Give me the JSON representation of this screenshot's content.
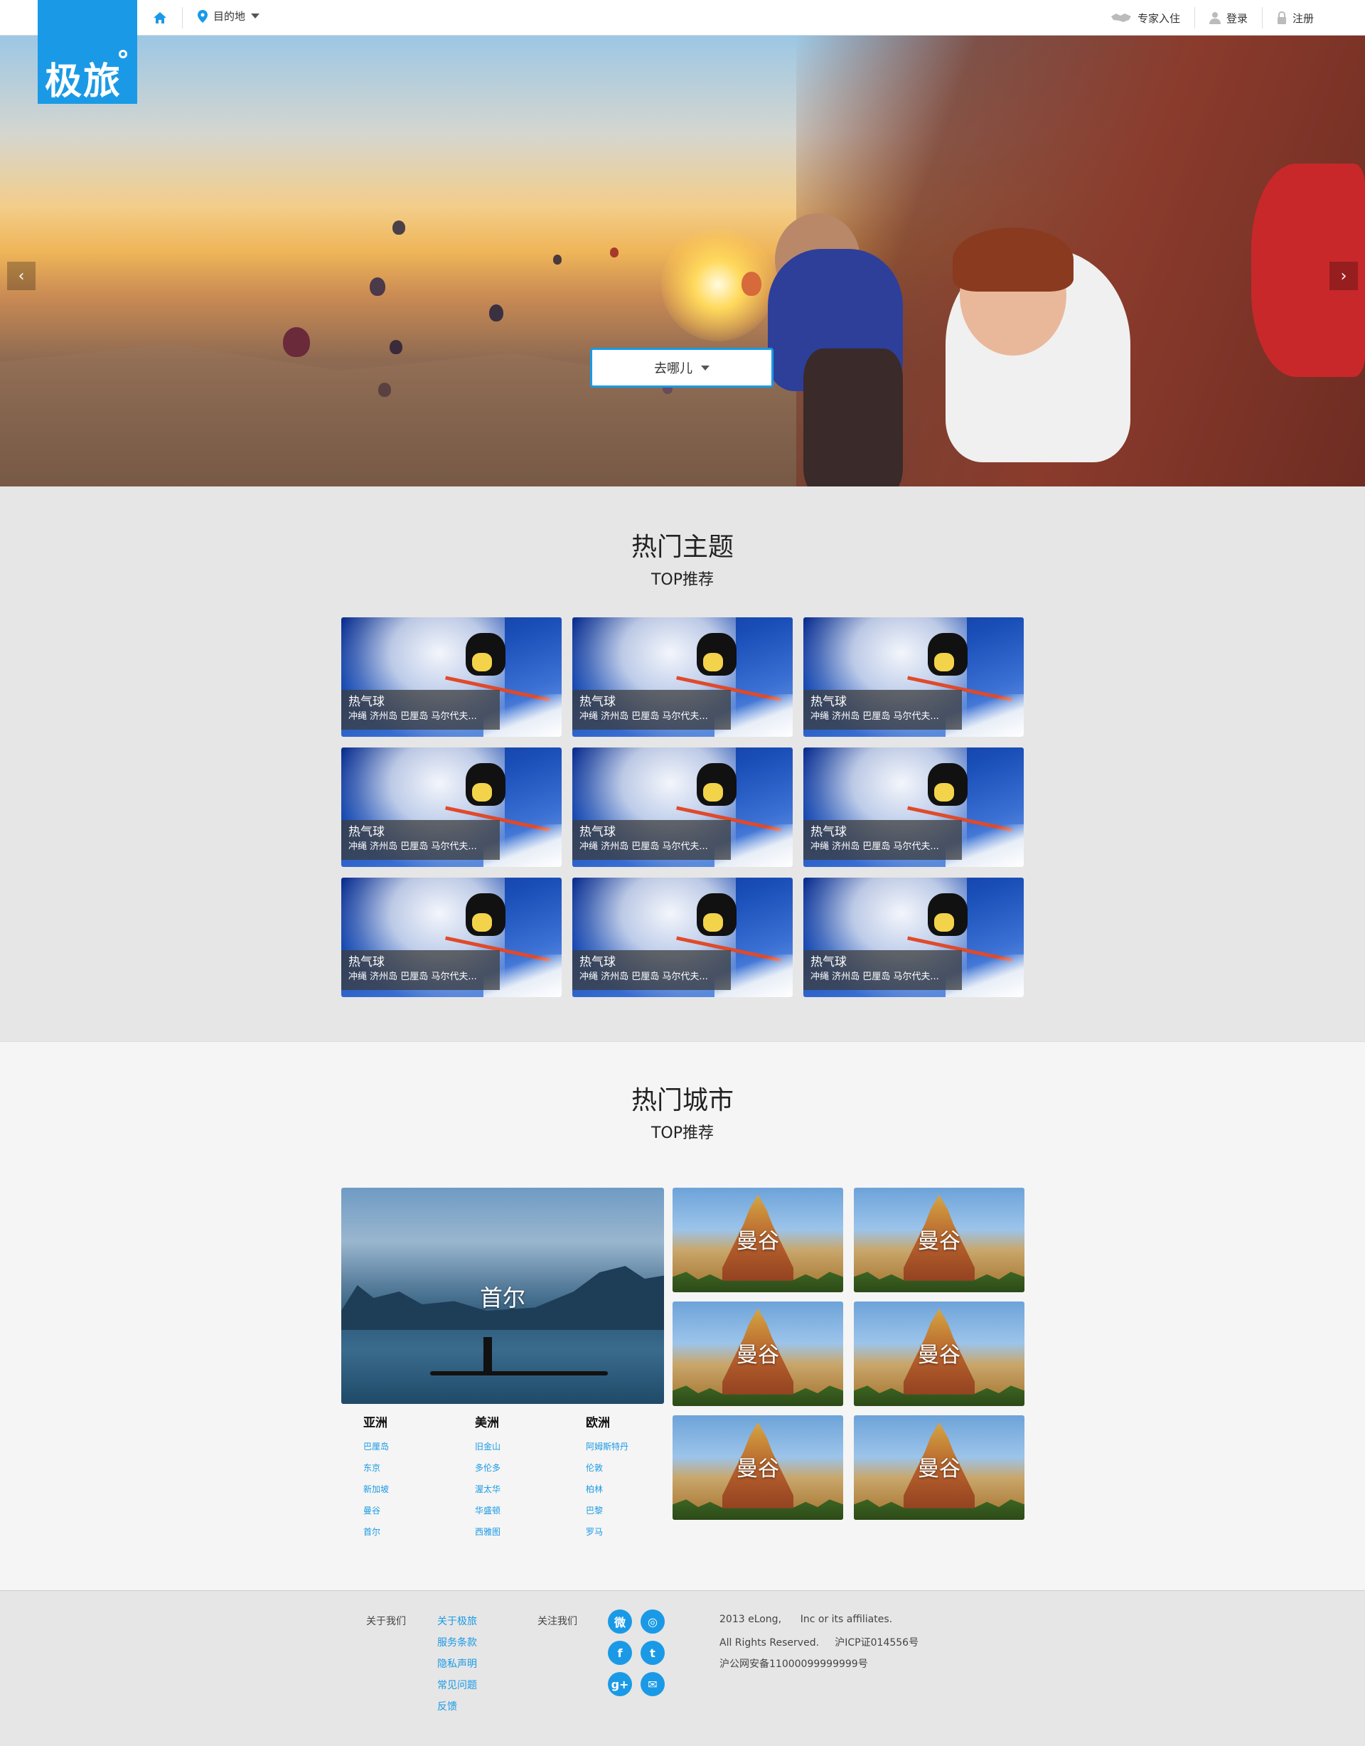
{
  "brand": {
    "logo_text": "极旅"
  },
  "topbar": {
    "destination_label": "目的地",
    "expert_label": "专家入住",
    "login_label": "登录",
    "register_label": "注册"
  },
  "hero": {
    "where_button": "去哪儿",
    "prev_arrow": "‹",
    "next_arrow": "›"
  },
  "themes": {
    "title": "热门主题",
    "subtitle": "TOP推荐",
    "cards": [
      {
        "name": "热气球",
        "desc": "冲绳 济州岛 巴厘岛 马尔代夫..."
      },
      {
        "name": "热气球",
        "desc": "冲绳 济州岛 巴厘岛 马尔代夫..."
      },
      {
        "name": "热气球",
        "desc": "冲绳 济州岛 巴厘岛 马尔代夫..."
      },
      {
        "name": "热气球",
        "desc": "冲绳 济州岛 巴厘岛 马尔代夫..."
      },
      {
        "name": "热气球",
        "desc": "冲绳 济州岛 巴厘岛 马尔代夫..."
      },
      {
        "name": "热气球",
        "desc": "冲绳 济州岛 巴厘岛 马尔代夫..."
      },
      {
        "name": "热气球",
        "desc": "冲绳 济州岛 巴厘岛 马尔代夫..."
      },
      {
        "name": "热气球",
        "desc": "冲绳 济州岛 巴厘岛 马尔代夫..."
      },
      {
        "name": "热气球",
        "desc": "冲绳 济州岛 巴厘岛 马尔代夫..."
      }
    ]
  },
  "cities": {
    "title": "热门城市",
    "subtitle": "TOP推荐",
    "featured": "首尔",
    "tiles": [
      "曼谷",
      "曼谷",
      "曼谷",
      "曼谷",
      "曼谷",
      "曼谷"
    ],
    "regions": [
      {
        "name": "亚洲",
        "links": [
          "巴厘岛",
          "东京",
          "新加坡",
          "曼谷",
          "首尔"
        ]
      },
      {
        "name": "美洲",
        "links": [
          "旧金山",
          "多伦多",
          "渥太华",
          "华盛顿",
          "西雅图"
        ]
      },
      {
        "name": "欧洲",
        "links": [
          "阿姆斯特丹",
          "伦敦",
          "柏林",
          "巴黎",
          "罗马"
        ]
      }
    ]
  },
  "footer": {
    "about_label": "关于我们",
    "links": [
      "关于极旅",
      "服务条款",
      "隐私声明",
      "常见问题",
      "反馈"
    ],
    "follow_label": "关注我们",
    "social": [
      "weibo-icon",
      "wechat-icon",
      "facebook-icon",
      "twitter-icon",
      "googleplus-icon",
      "email-icon"
    ],
    "copyright_line1": "2013 eLong,      Inc or its affiliates.",
    "copyright_line2": "All Rights Reserved.     沪ICP证014556号",
    "copyright_line3": "沪公网安备11000099999999号"
  },
  "colors": {
    "accent": "#1a9ae6",
    "page_bg": "#e6e6e6",
    "cities_bg": "#f5f5f5"
  }
}
